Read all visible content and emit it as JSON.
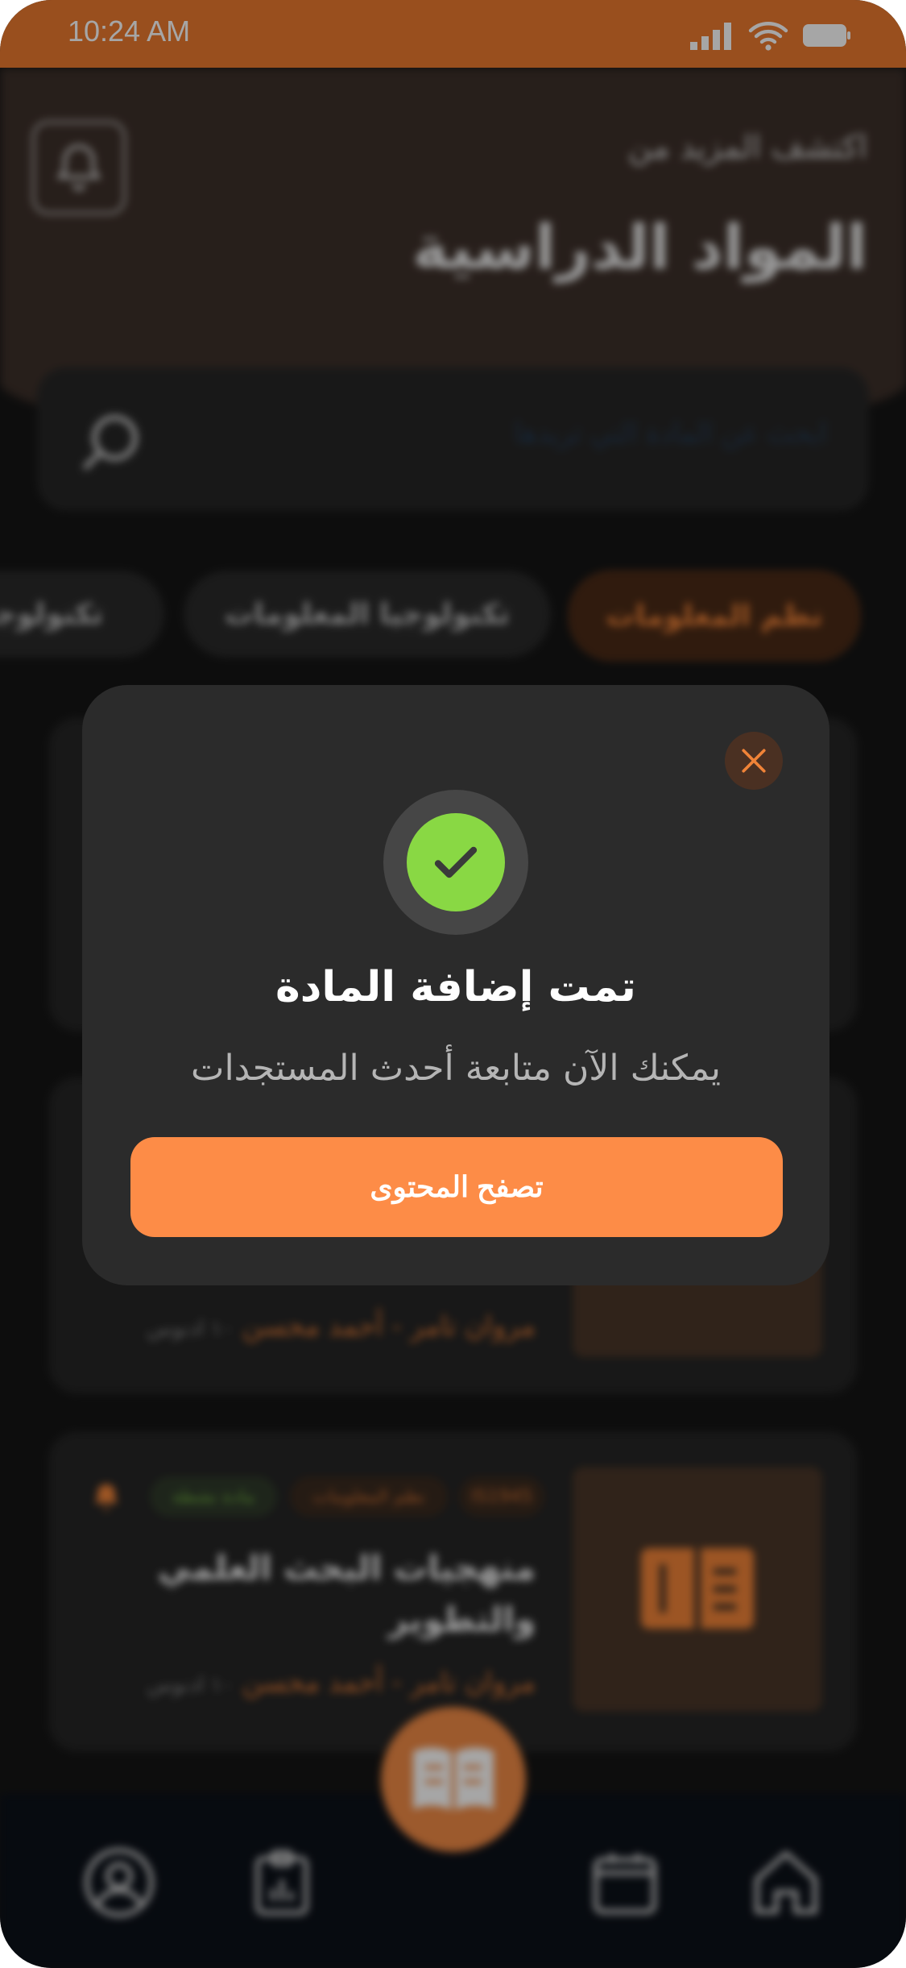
{
  "status_bar": {
    "time": "10:24 AM"
  },
  "header": {
    "discover": "اكتشف المزيد من",
    "title": "المواد الدراسية"
  },
  "search": {
    "placeholder": "ابحث عن المادة التي تريدها"
  },
  "filters": [
    {
      "label": "نظم المعلومات",
      "active": true
    },
    {
      "label": "تكنولوجيا المعلومات",
      "active": false
    },
    {
      "label": "تكنولوجيا",
      "active": false
    }
  ],
  "course_card_2": {
    "author": "مروان تامر - أحمد محسن",
    "time_ago": "١٠ ادنوس"
  },
  "course_card_3": {
    "code": "IS1945",
    "category": "نظم المعلومات",
    "status": "مادة نشطة",
    "title_line1": "منهجيات البحث العلمي",
    "title_line2": "والتطوير",
    "author": "مروان تامر - أحمد محسن",
    "time_ago": "١٠ ادنوس"
  },
  "modal": {
    "title": "تمت إضافة المادة",
    "subtitle": "يمكنك الآن متابعة أحدث  المستجدات",
    "button": "تصفح المحتوى"
  },
  "colors": {
    "accent": "#fd8c47",
    "success": "#89d844",
    "background": "#151515",
    "navbar": "#0c1119"
  },
  "nav_icons": [
    "profile-icon",
    "report-icon",
    "book-icon",
    "calendar-icon",
    "home-icon"
  ]
}
